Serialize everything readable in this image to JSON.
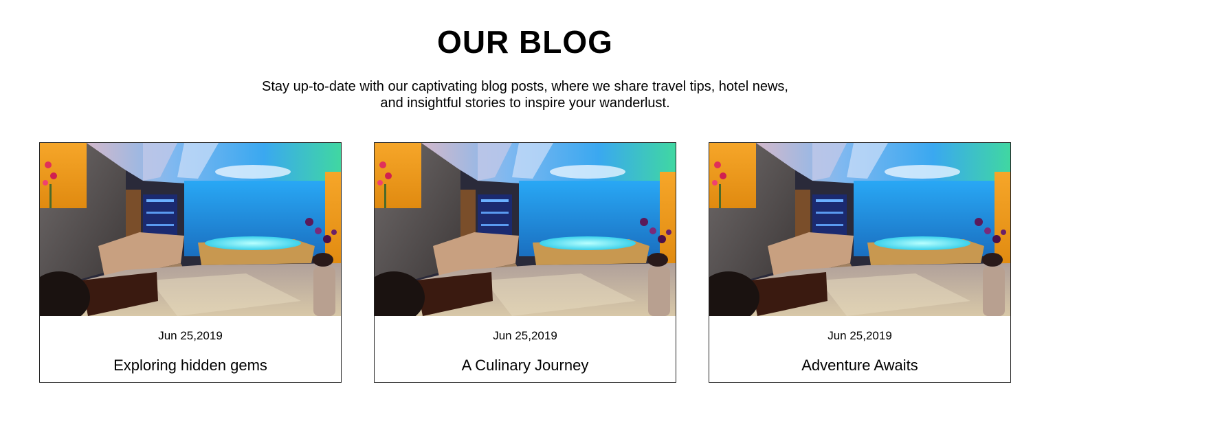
{
  "section": {
    "title": "OUR BLOG",
    "subtitle_line1": "Stay up-to-date with our captivating blog posts, where we share travel tips, hotel news,",
    "subtitle_line2": "and insightful stories to inspire your wanderlust."
  },
  "posts": [
    {
      "date": "Jun 25,2019",
      "title": "Exploring hidden gems",
      "image": "spa-jacuzzi-room-photo"
    },
    {
      "date": "Jun 25,2019",
      "title": "A Culinary Journey",
      "image": "spa-jacuzzi-room-photo"
    },
    {
      "date": "Jun 25,2019",
      "title": "Adventure Awaits",
      "image": "spa-jacuzzi-room-photo"
    }
  ],
  "colors": {
    "background": "#ffffff",
    "text": "#000000",
    "card_border": "#222222"
  }
}
